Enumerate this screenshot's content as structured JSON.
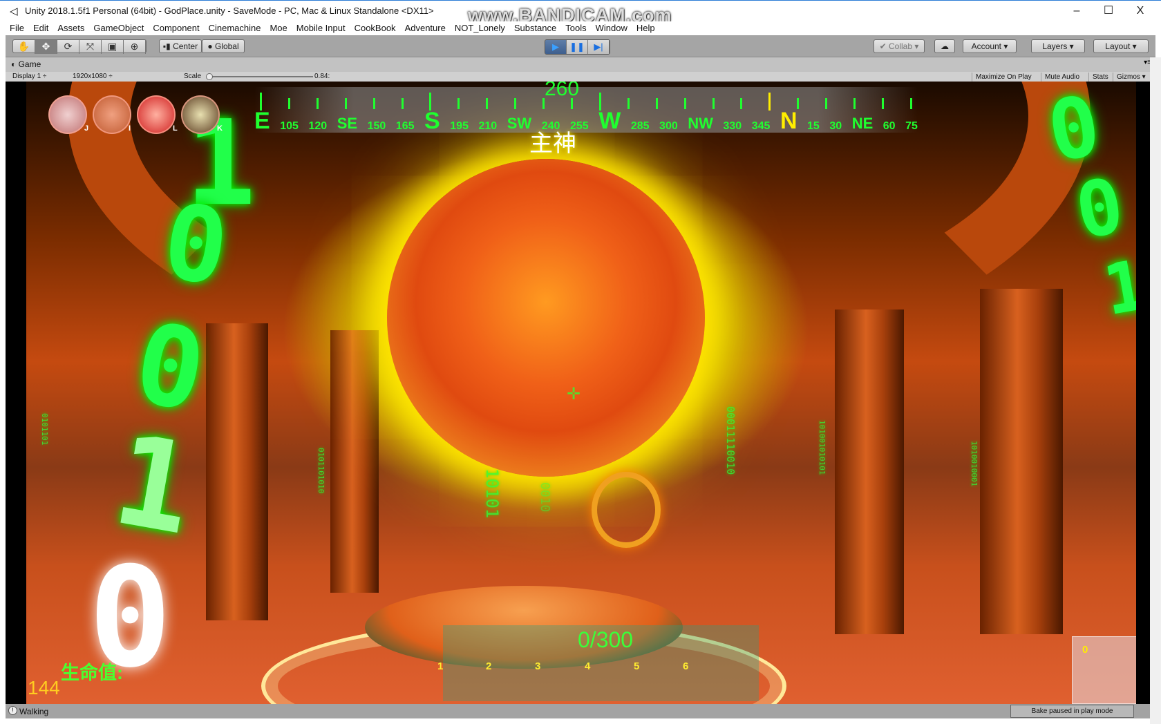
{
  "window": {
    "title": "Unity 2018.1.5f1 Personal (64bit) - GodPlace.unity - SaveMode - PC, Mac & Linux Standalone <DX11>",
    "watermark": "www.BANDICAM.com",
    "controls": {
      "minimize": "–",
      "maximize": "☐",
      "close": "X"
    }
  },
  "menu": [
    "File",
    "Edit",
    "Assets",
    "GameObject",
    "Component",
    "Cinemachine",
    "Moe",
    "Mobile Input",
    "CookBook",
    "Adventure",
    "NOT_Lonely",
    "Substance",
    "Tools",
    "Window",
    "Help"
  ],
  "toolbar": {
    "tools": [
      {
        "name": "hand-tool",
        "glyph": "✋"
      },
      {
        "name": "move-tool",
        "glyph": "✥"
      },
      {
        "name": "rotate-tool",
        "glyph": "⟳"
      },
      {
        "name": "scale-tool",
        "glyph": "⤧"
      },
      {
        "name": "rect-tool",
        "glyph": "▣"
      },
      {
        "name": "transform-tool",
        "glyph": "⊕"
      }
    ],
    "pivot": "Center",
    "space": "Global",
    "play": "▶",
    "pause": "❚❚",
    "step": "▶|",
    "collab": "Collab ▾",
    "cloud": "☁",
    "account": "Account ▾",
    "layers": "Layers ▾",
    "layout": "Layout ▾"
  },
  "game_tab": {
    "label": "Game",
    "display": "Display 1 ÷",
    "resolution": "1920x1080 ÷",
    "scale_label": "Scale",
    "scale_value": "0.84:",
    "buttons": [
      "Maximize On Play",
      "Mute Audio",
      "Stats",
      "Gizmos ▾"
    ]
  },
  "hud": {
    "skills": [
      {
        "key": "J",
        "icon": "eye-icon",
        "color": "#e6b0b0"
      },
      {
        "key": "I",
        "icon": "hands-icon",
        "color": "#e08a60"
      },
      {
        "key": "L",
        "icon": "lips-icon",
        "color": "#e04040"
      },
      {
        "key": "K",
        "icon": "praying-hands-icon",
        "color": "#8a9060"
      }
    ],
    "compass": {
      "heading": "260",
      "labels": [
        "E",
        "105",
        "120",
        "SE",
        "150",
        "165",
        "S",
        "195",
        "210",
        "SW",
        "240",
        "255",
        "W",
        "285",
        "300",
        "NW",
        "330",
        "345",
        "N",
        "15",
        "30",
        "NE",
        "60",
        "75"
      ]
    },
    "target_name": "主神",
    "progress": "0/300",
    "slots": [
      "1",
      "2",
      "3",
      "4",
      "5",
      "6"
    ],
    "hp_label": "生命值:",
    "hp_value": "144",
    "side_panel_value": "0",
    "binary_left": [
      "1",
      "0",
      "0",
      "1",
      "0"
    ],
    "binary_right": [
      "0",
      "0",
      "1"
    ]
  },
  "status": {
    "text": "Walking",
    "bake": "Bake paused in play mode"
  },
  "colors": {
    "hud_green": "#1fff2f",
    "hud_yellow": "#ffee00",
    "toolbar": "#a5a5a5",
    "play_active": "#3e5f8e"
  }
}
